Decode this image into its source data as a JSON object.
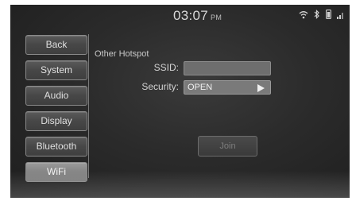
{
  "status_bar": {
    "time": "03:07",
    "ampm": "PM",
    "icons": [
      "wifi-icon",
      "bluetooth-icon",
      "phone-battery-icon",
      "signal-icon"
    ]
  },
  "sidebar": {
    "items": [
      {
        "label": "Back"
      },
      {
        "label": "System"
      },
      {
        "label": "Audio"
      },
      {
        "label": "Display"
      },
      {
        "label": "Bluetooth"
      },
      {
        "label": "WiFi",
        "active": true
      }
    ]
  },
  "main": {
    "section_title": "Other Hotspot",
    "ssid": {
      "label": "SSID:",
      "value": ""
    },
    "security": {
      "label": "Security:",
      "value": "OPEN"
    },
    "join_label": "Join"
  },
  "colors": {
    "background": "#2b2b2b",
    "active_item": "#858585",
    "text": "#d8d8d8"
  }
}
